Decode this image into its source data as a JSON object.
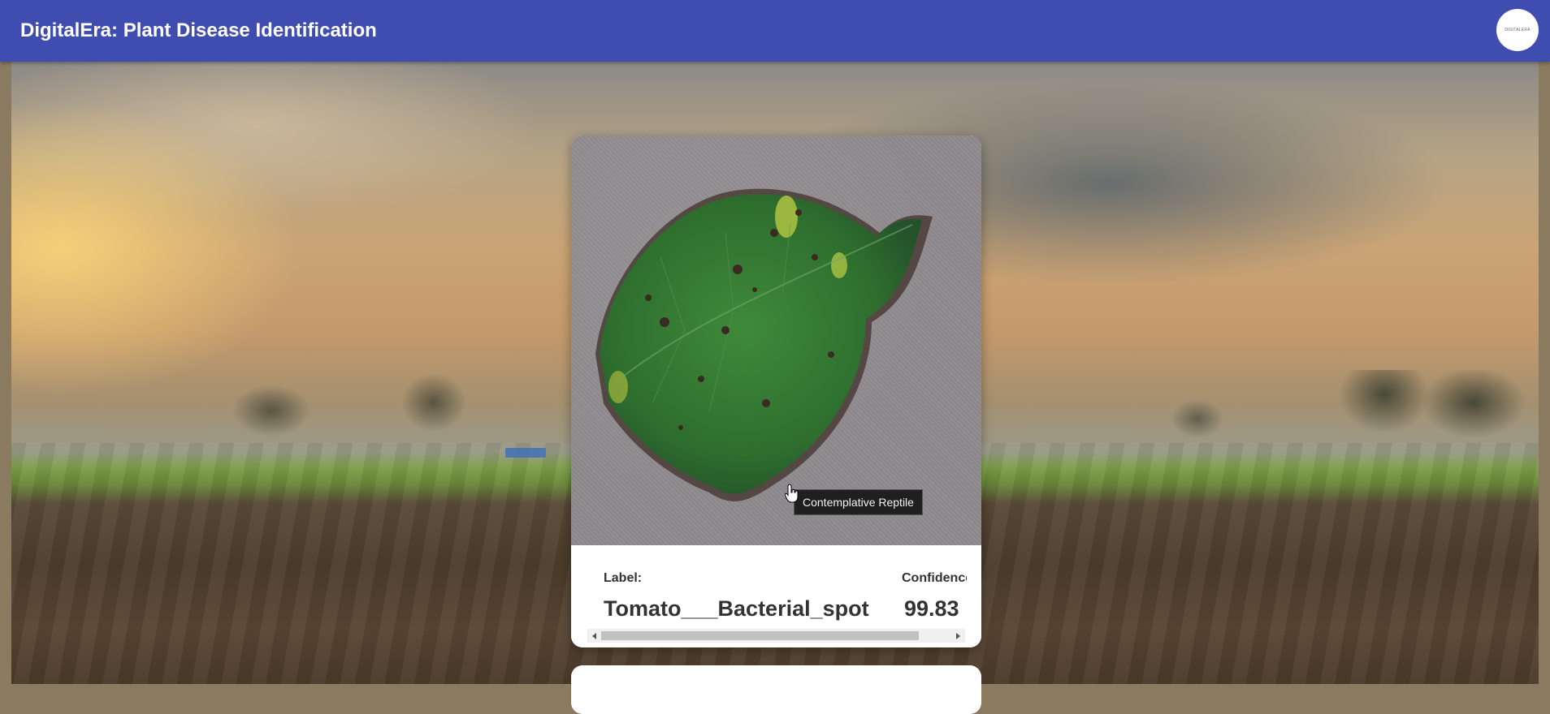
{
  "header": {
    "title": "DigitalEra: Plant Disease Identification",
    "avatar_text": "DIGITALERA",
    "color": "#3f4db0"
  },
  "result": {
    "label_heading": "Label:",
    "label_value": "Tomato___Bacterial_spot",
    "confidence_heading": "Confidence",
    "confidence_value": "99.83"
  },
  "tooltip": {
    "text": "Contemplative Reptile"
  },
  "icons": {
    "cursor": "hand-pointer-icon",
    "scroll_left": "arrow-left-icon",
    "scroll_right": "arrow-right-icon"
  }
}
